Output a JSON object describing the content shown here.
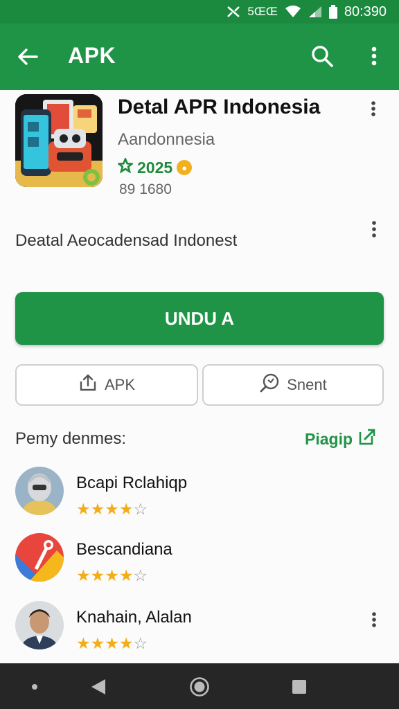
{
  "status_bar": {
    "time": "80:390",
    "indicator": "5ŒŒ",
    "icons": [
      "nfc-icon",
      "wifi-icon",
      "signal-icon",
      "battery-icon"
    ]
  },
  "app_bar": {
    "title": "APK",
    "icons": [
      "back-arrow-icon",
      "search-icon",
      "more-vert-icon"
    ]
  },
  "app": {
    "name": "Detal APR Indonesia",
    "developer": "Aandonnesia",
    "rating": "2025",
    "downloads": "89 1680",
    "description": "Deatal Aeocadensad Indonest"
  },
  "actions": {
    "install_label": "UNDU A",
    "apk_label": "APK",
    "share_label": "Snent"
  },
  "reviews": {
    "title": "Pemy denmes:",
    "link_label": "Piagip",
    "items": [
      {
        "name": "Bcapi Rclahiqp",
        "stars": 4
      },
      {
        "name": "Bescandiana",
        "stars": 4
      },
      {
        "name": "Knahain, Alalan",
        "stars": 4
      }
    ]
  },
  "colors": {
    "primary": "#1f9447",
    "status_bar": "#1b8a3e",
    "star": "#f3ad16",
    "nav_bar": "#262626"
  }
}
